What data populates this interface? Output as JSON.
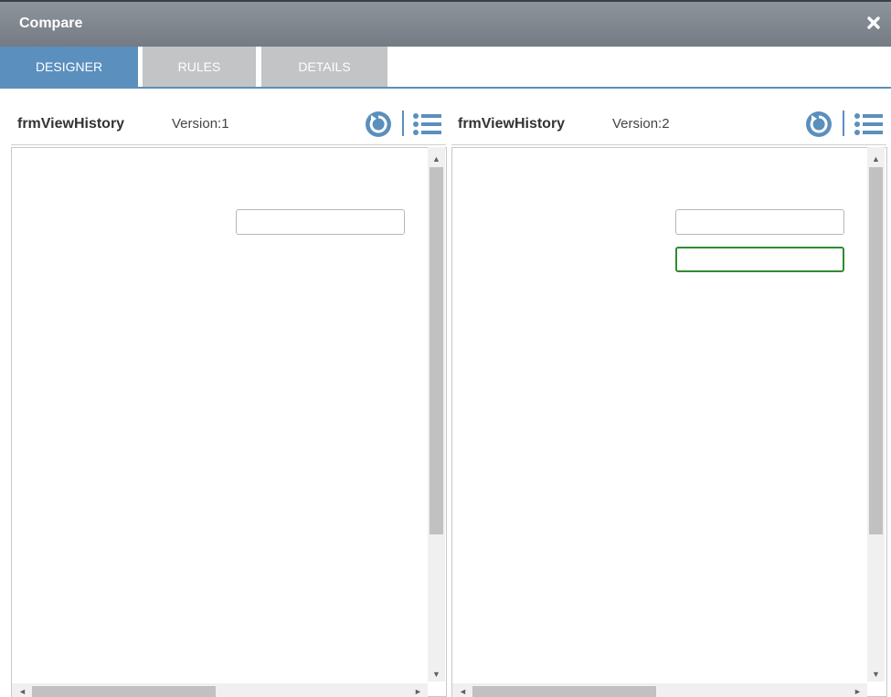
{
  "window": {
    "title": "Compare"
  },
  "tabs": [
    {
      "label": "DESIGNER",
      "active": true
    },
    {
      "label": "RULES",
      "active": false
    },
    {
      "label": "DETAILS",
      "active": false
    }
  ],
  "left_pane": {
    "form_name": "frmViewHistory",
    "version_label": "Version:1"
  },
  "right_pane": {
    "form_name": "frmViewHistory",
    "version_label": "Version:2"
  },
  "colors": {
    "accent": "#5b8fbd",
    "changed_field_border": "#2e8b2e",
    "titlebar": "#7f868e"
  },
  "icons": {
    "close": "close-icon",
    "refresh": "refresh-icon",
    "list": "list-icon"
  }
}
